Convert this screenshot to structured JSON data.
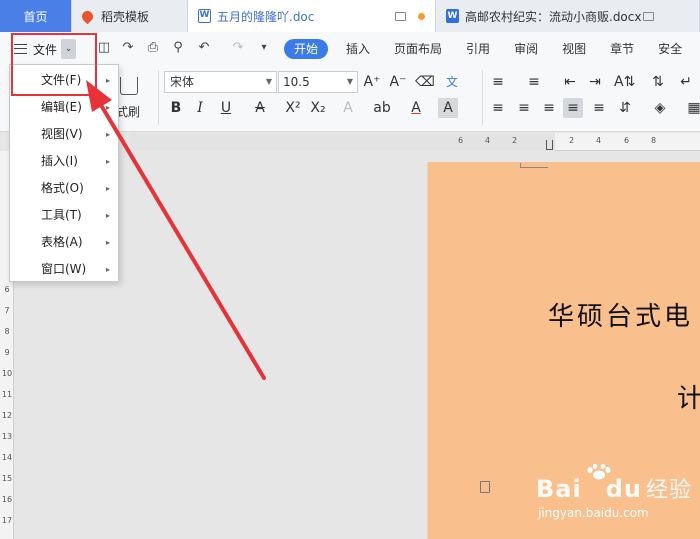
{
  "tabs": {
    "home": "首页",
    "template": "稻壳模板",
    "doc1": "五月的隆隆吖.doc",
    "doc2": "高邮农村纪实：流动小商贩.docx"
  },
  "ribbon": {
    "file_button": "文件",
    "tabs": [
      "开始",
      "插入",
      "页面布局",
      "引用",
      "审阅",
      "视图",
      "章节",
      "安全"
    ],
    "font_name": "宋体",
    "font_size": "10.5",
    "format_painter": "格式刷"
  },
  "file_menu": {
    "items": [
      {
        "label": "文件(F)"
      },
      {
        "label": "编辑(E)"
      },
      {
        "label": "视图(V)"
      },
      {
        "label": "插入(I)"
      },
      {
        "label": "格式(O)"
      },
      {
        "label": "工具(T)"
      },
      {
        "label": "表格(A)"
      },
      {
        "label": "窗口(W)"
      }
    ]
  },
  "ruler": {
    "h_ticks": [
      "6",
      "4",
      "2",
      "2",
      "4",
      "6",
      "8"
    ],
    "v_ticks": [
      "6",
      "7",
      "8",
      "9",
      "10",
      "11",
      "12",
      "13",
      "14",
      "15",
      "16",
      "17"
    ]
  },
  "document": {
    "title_line": "华硕台式电",
    "line2": "计"
  },
  "watermark": {
    "brand": "Bai",
    "brand_suffix": "du",
    "cn": "经验",
    "url": "jingyan.baidu.com"
  },
  "colors": {
    "accent": "#3b7be9",
    "highlight_box": "#e8323a",
    "page_bg": "#f9c08e"
  }
}
